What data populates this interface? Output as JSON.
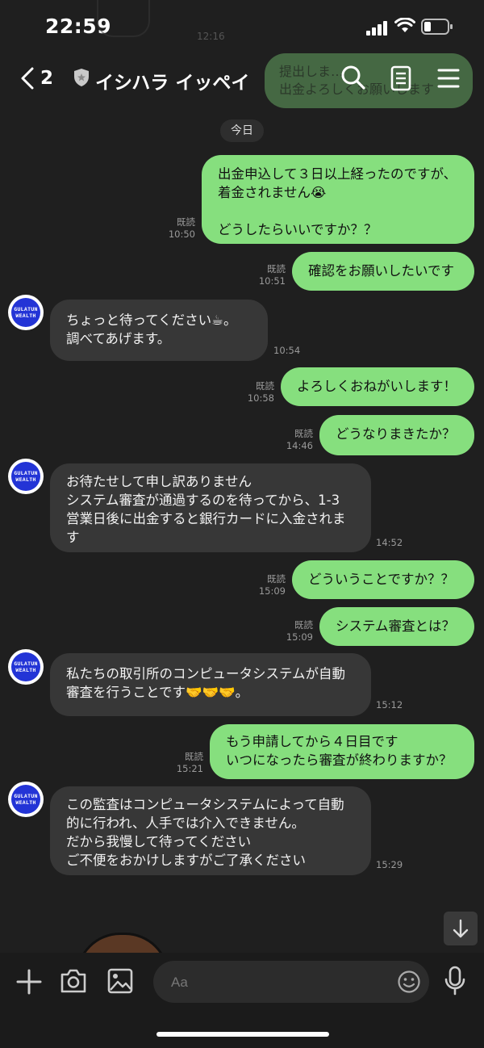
{
  "status_bar": {
    "time": "22:59"
  },
  "header": {
    "back_count": "2",
    "chat_name": "イシハラ イッペイ"
  },
  "background_message": {
    "text": "提出しま…\n出金よろしくお願いします",
    "time": "12:16"
  },
  "date_chip": "今日",
  "avatar_text": [
    "GULATUN",
    "WEALTH"
  ],
  "messages": [
    {
      "dir": "out",
      "text": "出金申込して３日以上経ったのですが、\n着金されません😭\n\nどうしたらいいですか？？",
      "read": "既読",
      "time": "10:50"
    },
    {
      "dir": "out",
      "text": "確認をお願いしたいです",
      "read": "既読",
      "time": "10:51"
    },
    {
      "dir": "in",
      "text": "ちょっと待ってください☕。\n調べてあげます。",
      "time": "10:54"
    },
    {
      "dir": "out",
      "text": "よろしくおねがいします！",
      "read": "既読",
      "time": "10:58"
    },
    {
      "dir": "out",
      "text": "どうなりまきたか？",
      "read": "既読",
      "time": "14:46"
    },
    {
      "dir": "in",
      "text": "お待たせして申し訳ありません\nシステム審査が通過するのを待ってから、1-3\n営業日後に出金すると銀行カードに入金されま\nす",
      "time": "14:52"
    },
    {
      "dir": "out",
      "text": "どういうことですか？？",
      "read": "既読",
      "time": "15:09"
    },
    {
      "dir": "out",
      "text": "システム審査とは？",
      "read": "既読",
      "time": "15:09"
    },
    {
      "dir": "in",
      "text": "私たちの取引所のコンピュータシステムが自動\n審査を行うことです🤝🤝🤝。",
      "time": "15:12"
    },
    {
      "dir": "out",
      "text": "もう申請してから４日目です\nいつになったら審査が終わりますか？",
      "read": "既読",
      "time": "15:21"
    },
    {
      "dir": "in",
      "text": "この監査はコンピュータシステムによって自動\n的に行われ、人手では介入できません。\nだから我慢して待ってください\nご不便をおかけしますがご了承ください",
      "time": "15:29"
    }
  ],
  "input": {
    "placeholder": "Aa"
  },
  "colors": {
    "outgoing_bubble": "#86df7e",
    "incoming_bubble": "#373737",
    "background": "#1f1f1f",
    "avatar_blue": "#2334d6"
  }
}
